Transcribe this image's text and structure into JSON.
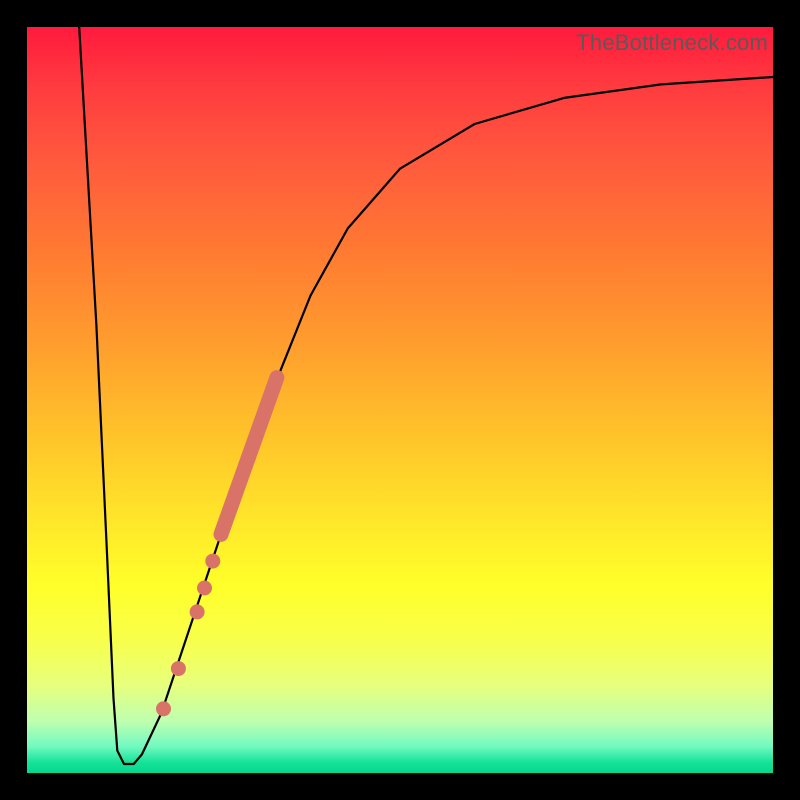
{
  "watermark": "TheBottleneck.com",
  "chart_data": {
    "type": "line",
    "title": "",
    "xlabel": "",
    "ylabel": "",
    "xlim": [
      0,
      100
    ],
    "ylim": [
      0,
      100
    ],
    "curve": [
      {
        "x": 7.0,
        "y": 100.0
      },
      {
        "x": 9.3,
        "y": 60.0
      },
      {
        "x": 10.7,
        "y": 30.0
      },
      {
        "x": 11.6,
        "y": 10.0
      },
      {
        "x": 12.1,
        "y": 3.0
      },
      {
        "x": 13.0,
        "y": 1.2
      },
      {
        "x": 14.3,
        "y": 1.2
      },
      {
        "x": 15.4,
        "y": 2.5
      },
      {
        "x": 18.0,
        "y": 8.0
      },
      {
        "x": 22.0,
        "y": 20.0
      },
      {
        "x": 26.0,
        "y": 32.0
      },
      {
        "x": 30.0,
        "y": 43.0
      },
      {
        "x": 34.0,
        "y": 54.0
      },
      {
        "x": 38.0,
        "y": 64.0
      },
      {
        "x": 43.0,
        "y": 73.0
      },
      {
        "x": 50.0,
        "y": 81.0
      },
      {
        "x": 60.0,
        "y": 87.0
      },
      {
        "x": 72.0,
        "y": 90.5
      },
      {
        "x": 85.0,
        "y": 92.3
      },
      {
        "x": 100.0,
        "y": 93.3
      }
    ],
    "highlight_segment": {
      "start": {
        "x": 26.0,
        "y": 32.0
      },
      "end": {
        "x": 33.5,
        "y": 53.0
      }
    },
    "dots": [
      {
        "x": 18.3,
        "y": 8.6
      },
      {
        "x": 20.3,
        "y": 14.0
      },
      {
        "x": 22.8,
        "y": 21.6
      },
      {
        "x": 23.8,
        "y": 24.8
      },
      {
        "x": 24.9,
        "y": 28.4
      }
    ]
  }
}
